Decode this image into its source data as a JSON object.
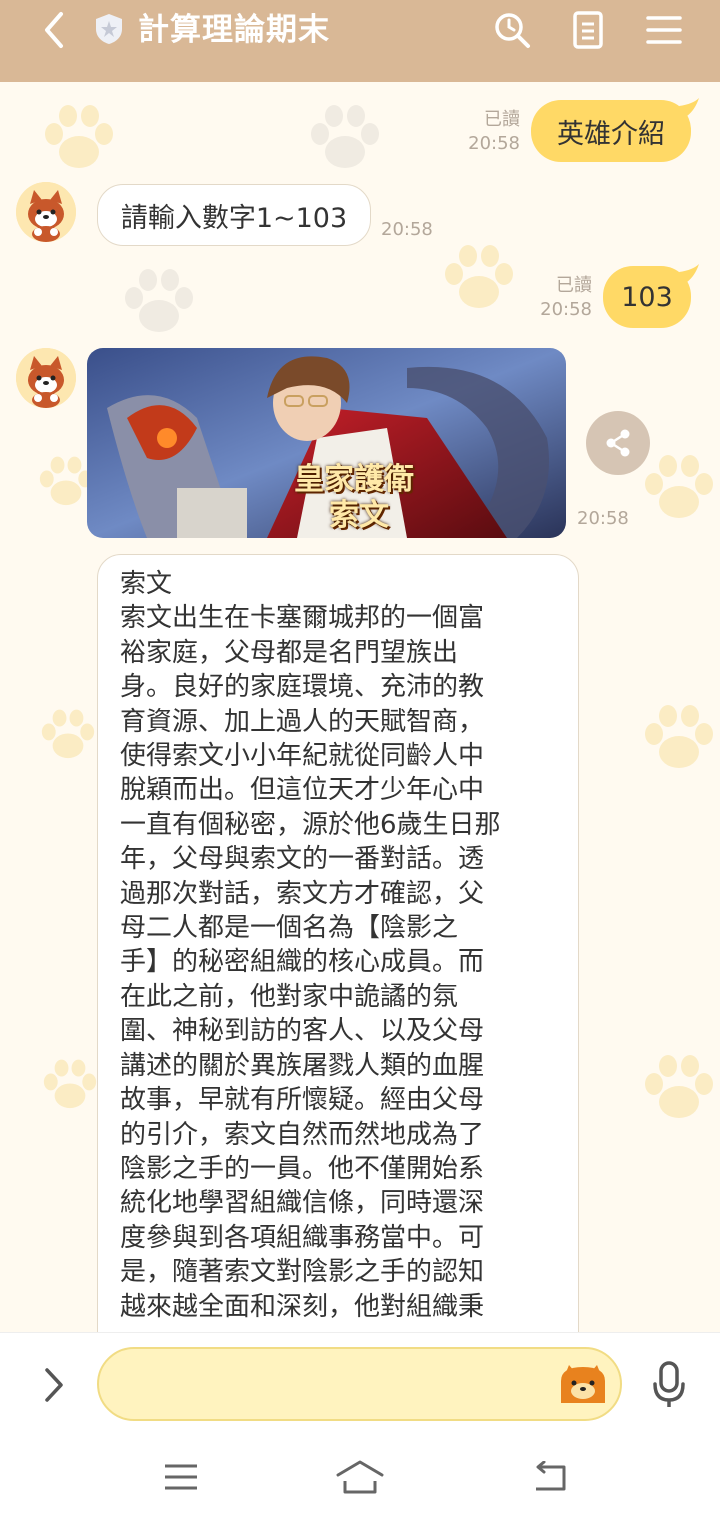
{
  "header": {
    "title": "計算理論期末",
    "back_icon": "chevron-left-icon",
    "badge_icon": "shield-star-icon",
    "search_icon": "search-icon",
    "notes_icon": "document-icon",
    "menu_icon": "menu-icon",
    "background_color": "#d9b896"
  },
  "messages": [
    {
      "sender": "me",
      "text": "英雄介紹",
      "read_label": "已讀",
      "time": "20:58"
    },
    {
      "sender": "bot",
      "text": "請輸入數字1~103",
      "time": "20:58"
    },
    {
      "sender": "me",
      "text": "103",
      "read_label": "已讀",
      "time": "20:58"
    },
    {
      "sender": "bot",
      "type": "image-card",
      "card_title_line1": "皇家護衛",
      "card_title_line2": "索文",
      "time": "20:58"
    },
    {
      "sender": "bot",
      "type": "long-text",
      "text": "索文\n索文出生在卡塞爾城邦的一個富\n裕家庭，父母都是名門望族出\n身。良好的家庭環境、充沛的教\n育資源、加上過人的天賦智商，\n使得索文小小年紀就從同齡人中\n脫穎而出。但這位天才少年心中\n一直有個秘密，源於他6歲生日那\n年，父母與索文的一番對話。透\n過那次對話，索文方才確認，父\n母二人都是一個名為【陰影之\n手】的秘密組織的核心成員。而\n在此之前，他對家中詭譎的氛\n圍、神秘到訪的客人、以及父母\n講述的關於異族屠戮人類的血腥\n故事，早就有所懷疑。經由父母\n的引介，索文自然而然地成為了\n陰影之手的一員。他不僅開始系\n統化地學習組織信條，同時還深\n度參與到各項組織事務當中。可\n是，隨著索文對陰影之手的認知\n越來越全面和深刻，他對組織秉"
    }
  ],
  "share_icon": "share-icon",
  "bottom": {
    "expand_icon": "chevron-right-icon",
    "sticker_icon": "bread-sticker-icon",
    "mic_icon": "microphone-icon",
    "nav_menu_icon": "nav-menu-icon",
    "nav_home_icon": "nav-home-icon",
    "nav_back_icon": "nav-back-icon"
  },
  "colors": {
    "my_bubble": "#ffd966",
    "chat_bg": "#fffaf0",
    "input_bg": "#fff3bf"
  }
}
